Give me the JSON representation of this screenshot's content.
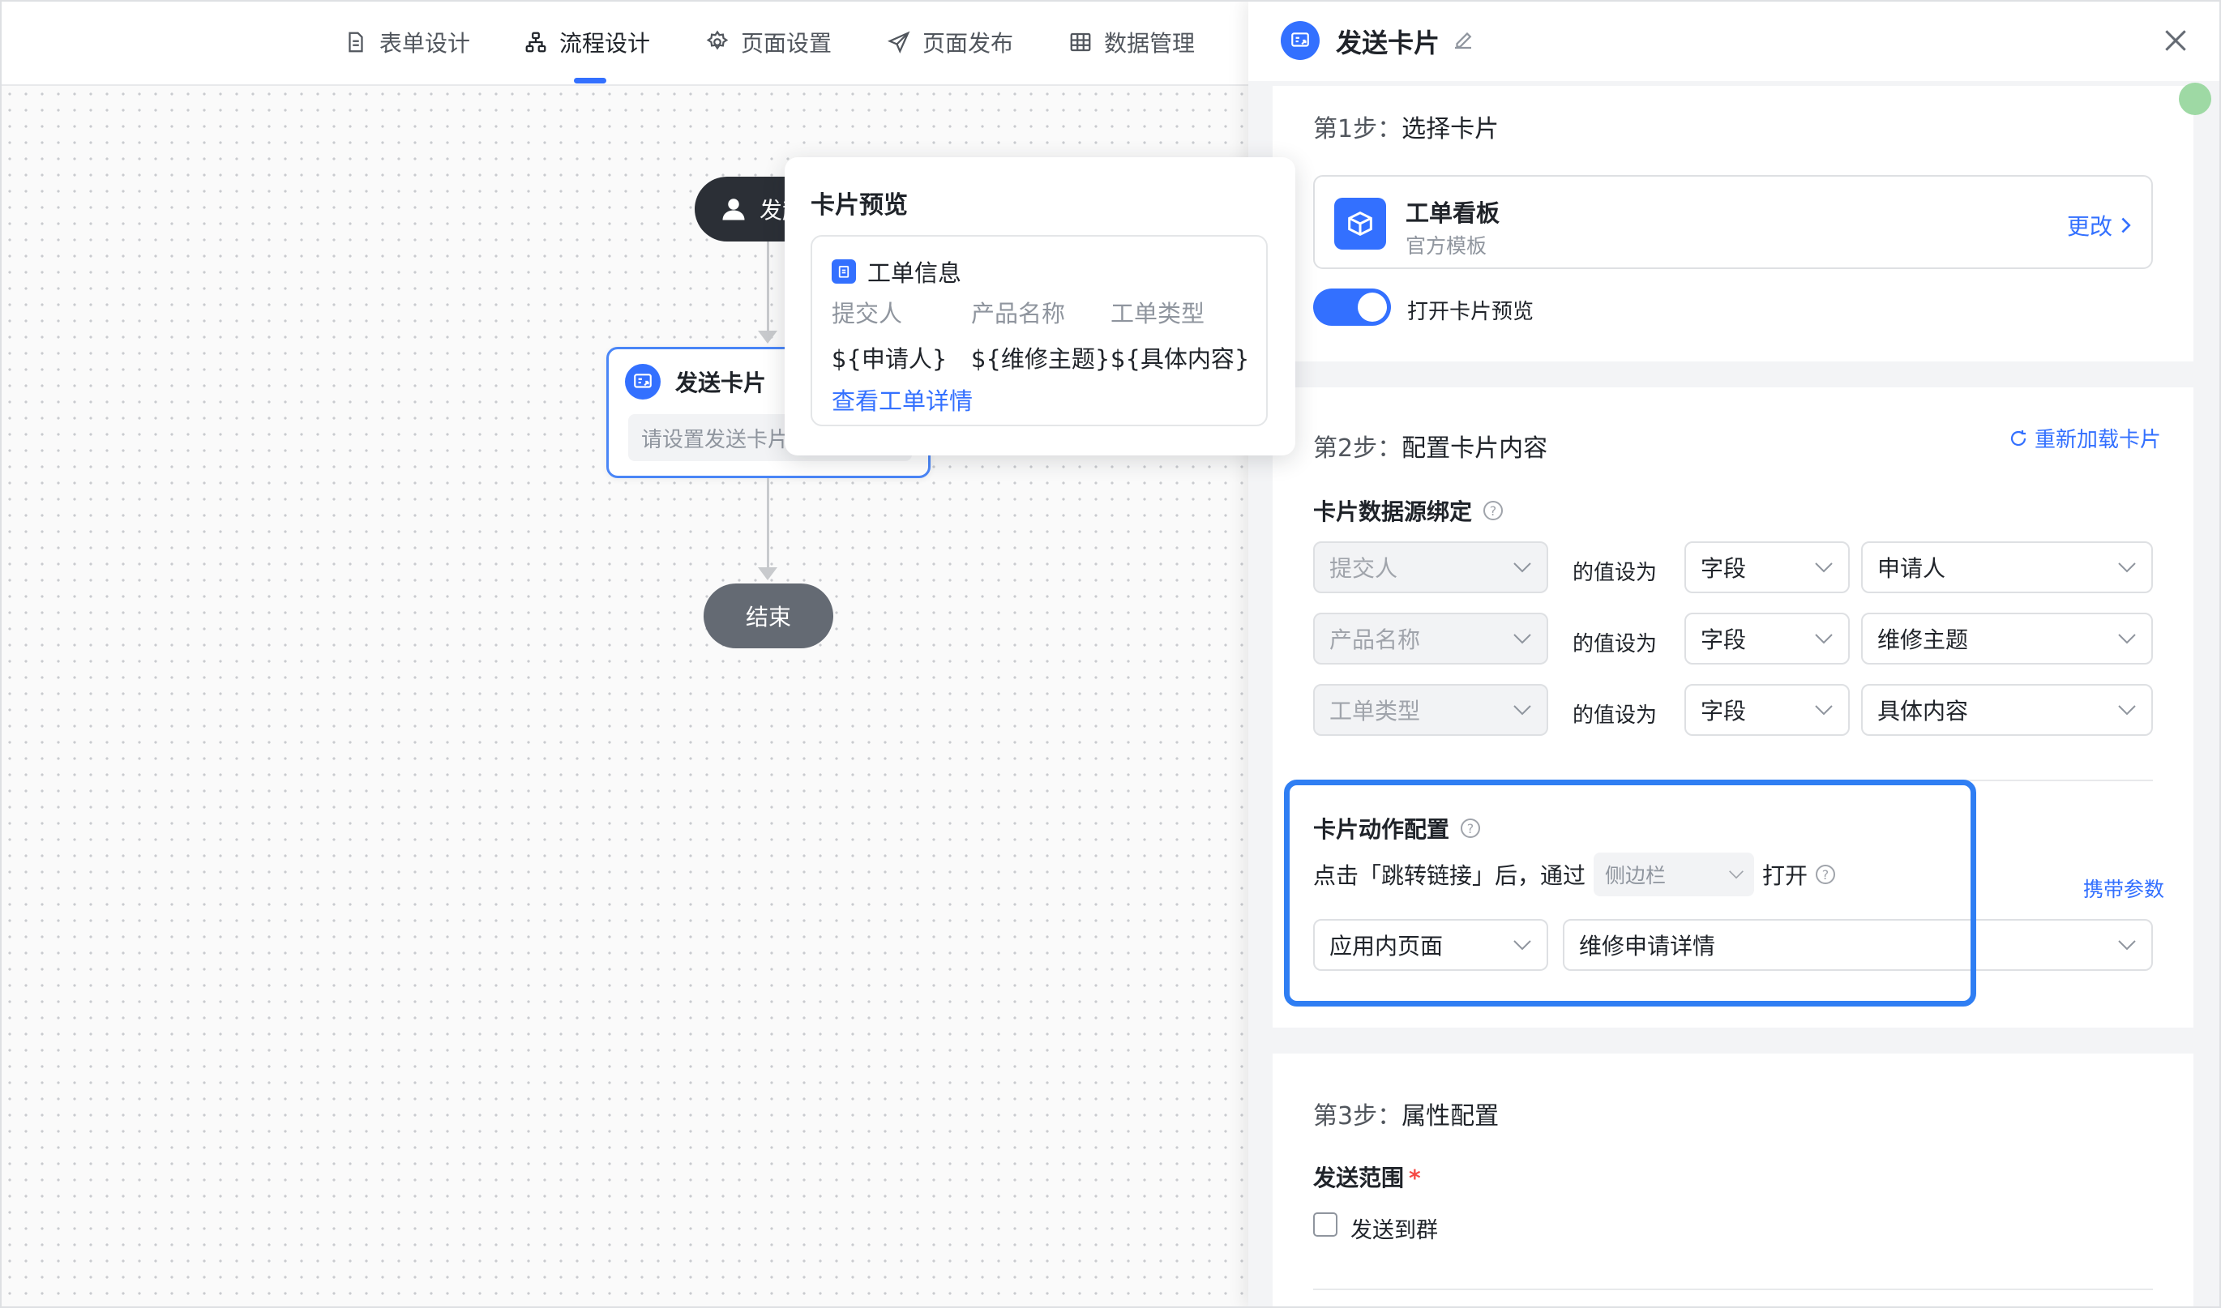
{
  "nav": {
    "tabs": [
      {
        "label": "表单设计",
        "icon": "document-icon"
      },
      {
        "label": "流程设计",
        "icon": "flow-icon"
      },
      {
        "label": "页面设置",
        "icon": "gear-icon"
      },
      {
        "label": "页面发布",
        "icon": "send-icon"
      },
      {
        "label": "数据管理",
        "icon": "table-icon"
      }
    ],
    "active_index": 1
  },
  "canvas": {
    "start_node": "发起",
    "card_node": {
      "title": "发送卡片",
      "placeholder": "请设置发送卡片"
    },
    "end_node": "结束"
  },
  "preview": {
    "title": "卡片预览",
    "card_title": "工单信息",
    "columns": [
      {
        "label": "提交人",
        "value": "${申请人}"
      },
      {
        "label": "产品名称",
        "value": "${维修主题}"
      },
      {
        "label": "工单类型",
        "value": "${具体内容}"
      }
    ],
    "link": "查看工单详情"
  },
  "drawer": {
    "title": "发送卡片",
    "step1": {
      "title_num": "第1步：",
      "title_text": "选择卡片",
      "template_name": "工单看板",
      "template_sub": "官方模板",
      "change": "更改",
      "toggle_label": "打开卡片预览",
      "toggle_on": true
    },
    "step2": {
      "title_num": "第2步：",
      "title_text": "配置卡片内容",
      "reload": "重新加载卡片",
      "binding_title": "卡片数据源绑定",
      "value_as": "的值设为",
      "rows": [
        {
          "target": "提交人",
          "type": "字段",
          "value": "申请人"
        },
        {
          "target": "产品名称",
          "type": "字段",
          "value": "维修主题"
        },
        {
          "target": "工单类型",
          "type": "字段",
          "value": "具体内容"
        }
      ],
      "action_title": "卡片动作配置",
      "action_prefix": "点击「跳转链接」后，通过",
      "action_via": "侧边栏",
      "action_suffix": "打开",
      "carry_params": "携带参数",
      "page_type": "应用内页面",
      "page_value": "维修申请详情"
    },
    "step3": {
      "title_num": "第3步：",
      "title_text": "属性配置",
      "send_range": "发送范围",
      "required_mark": "*",
      "send_group": "发送到群"
    }
  },
  "colors": {
    "accent": "#3370ff",
    "highlight": "#2f7ef3",
    "start_node": "#2b2f36",
    "end_node": "#646a73"
  }
}
